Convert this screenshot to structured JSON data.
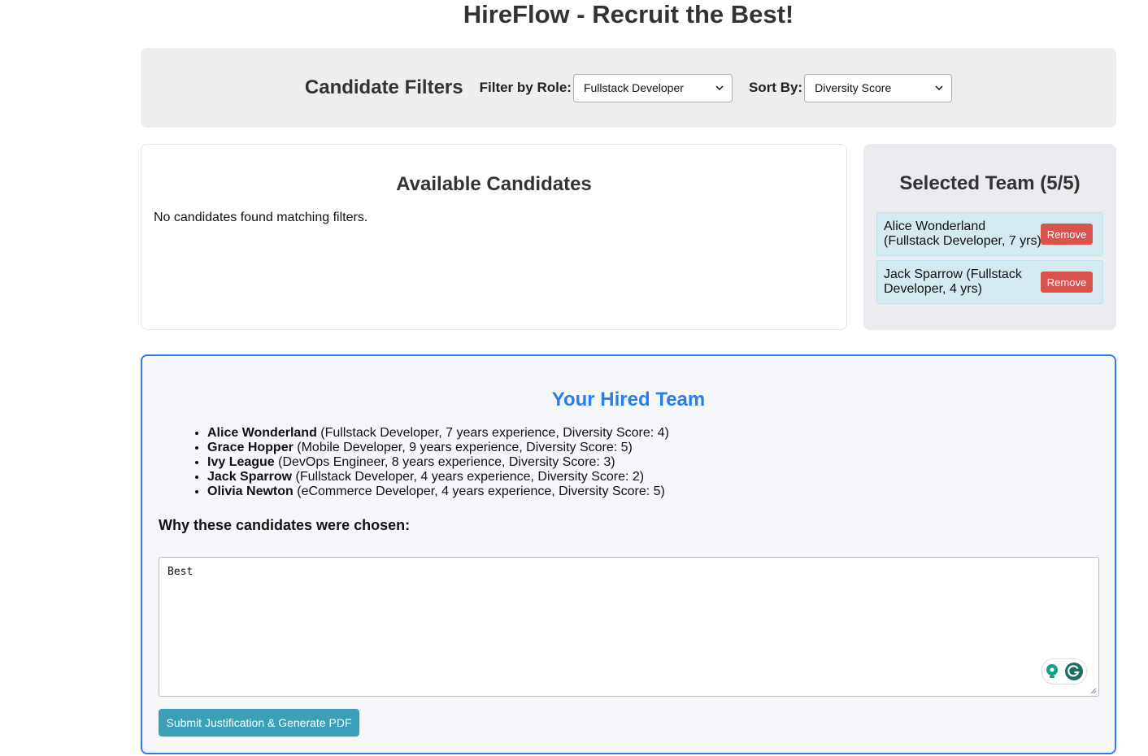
{
  "title": "HireFlow - Recruit the Best!",
  "filters": {
    "heading": "Candidate Filters",
    "role_label": "Filter by Role:",
    "role_value": "Fullstack Developer",
    "sort_label": "Sort By:",
    "sort_value": "Diversity Score"
  },
  "available": {
    "heading": "Available Candidates",
    "empty_message": "No candidates found matching filters."
  },
  "selected": {
    "heading": "Selected Team (5/5)",
    "items": [
      {
        "label": "Alice Wonderland (Fullstack Developer, 7 yrs)",
        "button": "Remove"
      },
      {
        "label": "Jack Sparrow (Fullstack Developer, 4 yrs)",
        "button": "Remove"
      }
    ]
  },
  "hired": {
    "heading": "Your Hired Team",
    "members": [
      {
        "name": "Alice Wonderland",
        "details": " (Fullstack Developer, 7 years experience, Diversity Score: 4)"
      },
      {
        "name": "Grace Hopper",
        "details": " (Mobile Developer, 9 years experience, Diversity Score: 5)"
      },
      {
        "name": "Ivy League",
        "details": " (DevOps Engineer, 8 years experience, Diversity Score: 3)"
      },
      {
        "name": "Jack Sparrow",
        "details": " (Fullstack Developer, 4 years experience, Diversity Score: 2)"
      },
      {
        "name": "Olivia Newton",
        "details": " (eCommerce Developer, 4 years experience, Diversity Score: 5)"
      }
    ],
    "why_label": "Why these candidates were chosen:",
    "justification": "Best",
    "submit_label": "Submit Justification & Generate PDF"
  },
  "colors": {
    "accent": "#2b7de9",
    "remove": "#d9534f",
    "submit": "#3aa0b8"
  }
}
